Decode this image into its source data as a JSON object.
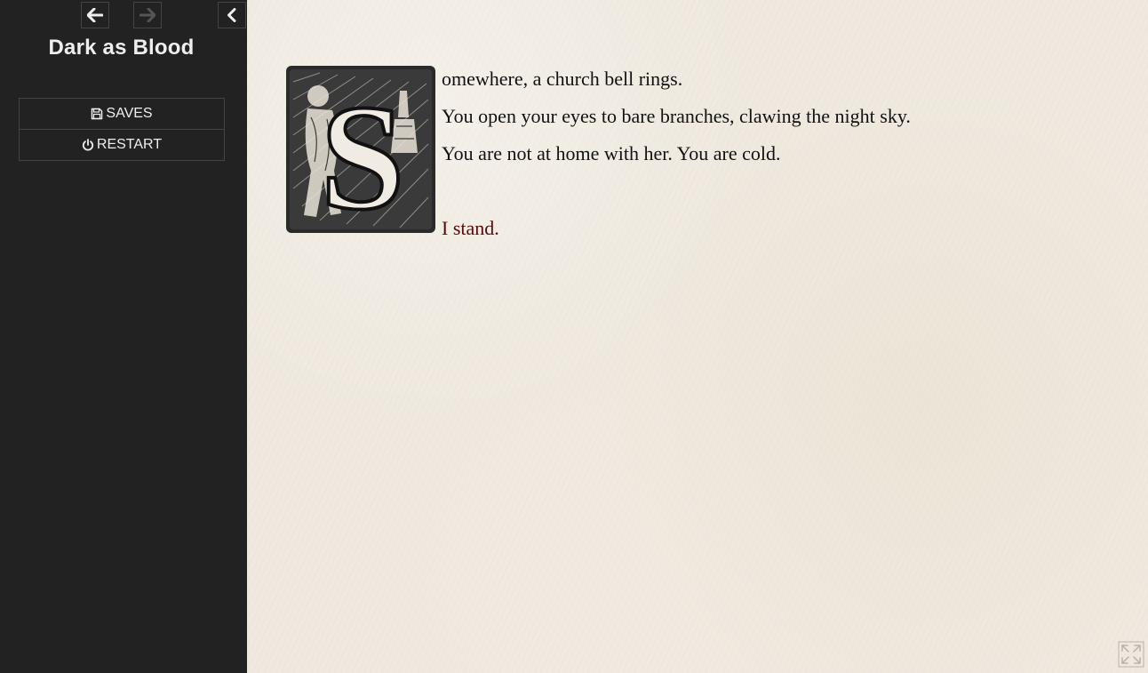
{
  "sidebar": {
    "title": "Dark as Blood",
    "nav": {
      "back_icon": "arrow-left-icon",
      "forward_icon": "arrow-right-icon",
      "forward_enabled": false,
      "toggle_icon": "chevron-left-icon"
    },
    "menu": [
      {
        "label": "SAVES",
        "icon": "floppy-disk-icon"
      },
      {
        "label": "RESTART",
        "icon": "power-icon"
      }
    ]
  },
  "passage": {
    "dropcap_letter": "S",
    "lines": [
      "omewhere, a church bell rings.",
      "You open your eyes to bare branches, clawing the night sky.",
      "You are not at home with her. You are cold."
    ],
    "choice": "I stand."
  },
  "colors": {
    "sidebar_bg": "#222222",
    "sidebar_text": "#eeeeee",
    "page_bg": "#efe9df",
    "link": "#5a0a0a",
    "disabled_icon": "#555555"
  },
  "fullscreen_icon": "fullscreen-icon"
}
